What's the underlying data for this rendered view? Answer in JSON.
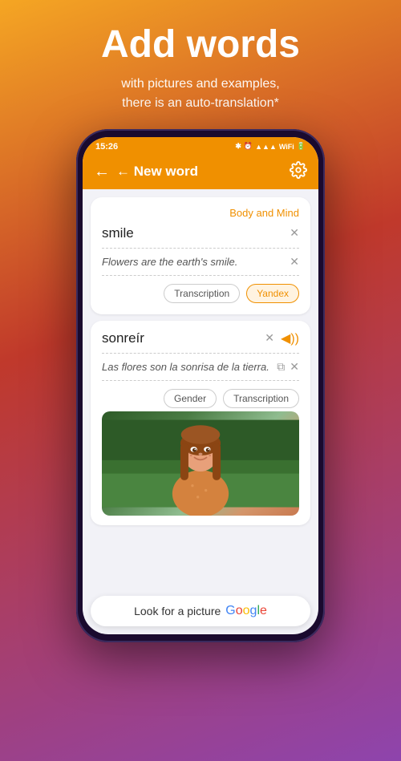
{
  "promo": {
    "title": "Add words",
    "subtitle": "with pictures and examples,\nthere is an auto-translation*"
  },
  "statusBar": {
    "time": "15:26",
    "icons": "🔵 ⏰ 📶 WiFi 🔋"
  },
  "navBar": {
    "backLabel": "← New word",
    "settingsIcon": "⚙"
  },
  "card": {
    "categoryLabel": "Body and Mind",
    "wordValue": "smile",
    "exampleValue": "Flowers are the earth's smile.",
    "transcriptionBtn": "Transcription",
    "yandexBtn": "Yandex"
  },
  "translationCard": {
    "wordValue": "sonreír",
    "exampleValue": "Las flores son la sonrisa de la tierra.",
    "genderBtn": "Gender",
    "transcriptionBtn": "Transcription"
  },
  "googleBar": {
    "label": "Look for a picture",
    "googleText": "Google"
  }
}
